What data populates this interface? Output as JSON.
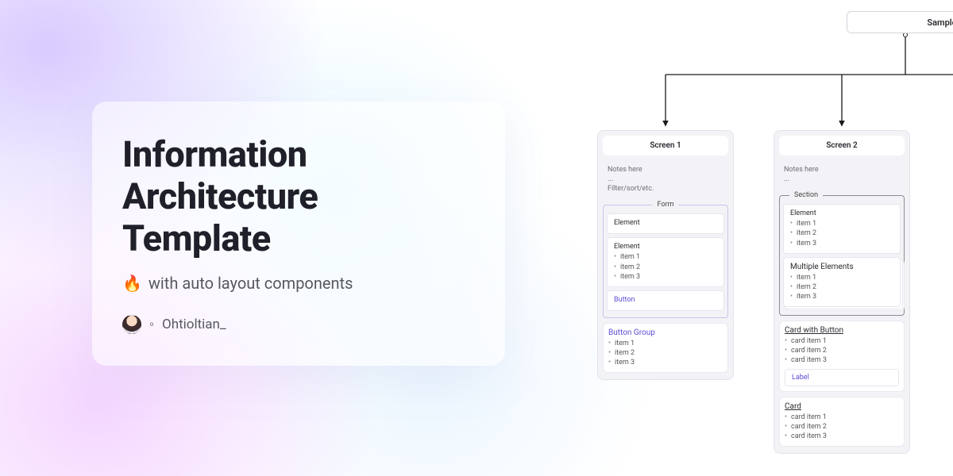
{
  "hero": {
    "title_line1": "Information",
    "title_line2": "Architecture",
    "title_line3": "Template",
    "subtitle": "with auto layout components",
    "fire_icon": "🔥",
    "diamond": "◦",
    "author": "Ohtioltian_"
  },
  "diagram": {
    "root": "Sample",
    "screens": [
      {
        "title": "Screen 1",
        "notes": [
          "Notes here",
          "...",
          "Filter/sort/etc."
        ],
        "form": {
          "legend": "Form",
          "items": [
            {
              "type": "element",
              "label": "Element"
            },
            {
              "type": "element_list",
              "label": "Element",
              "items": [
                "item 1",
                "item 2",
                "item 3"
              ]
            },
            {
              "type": "button",
              "label": "Button"
            }
          ]
        },
        "button_group": {
          "label": "Button Group",
          "items": [
            "item 1",
            "item 2",
            "item 3"
          ]
        }
      },
      {
        "title": "Screen 2",
        "notes": [
          "Notes here",
          "..."
        ],
        "section": {
          "legend": "Section",
          "element": {
            "label": "Element",
            "items": [
              "item 1",
              "item 2",
              "item 3"
            ]
          },
          "multi": {
            "label": "Multiple Elements",
            "items": [
              "item 1",
              "item 2",
              "item 3"
            ]
          }
        },
        "card_button": {
          "label": "Card with Button",
          "items": [
            "card item 1",
            "card item 2",
            "card item 3"
          ],
          "button_label": "Label"
        },
        "card": {
          "label": "Card",
          "items": [
            "card item 1",
            "card item 2",
            "card item 3"
          ]
        }
      }
    ]
  }
}
